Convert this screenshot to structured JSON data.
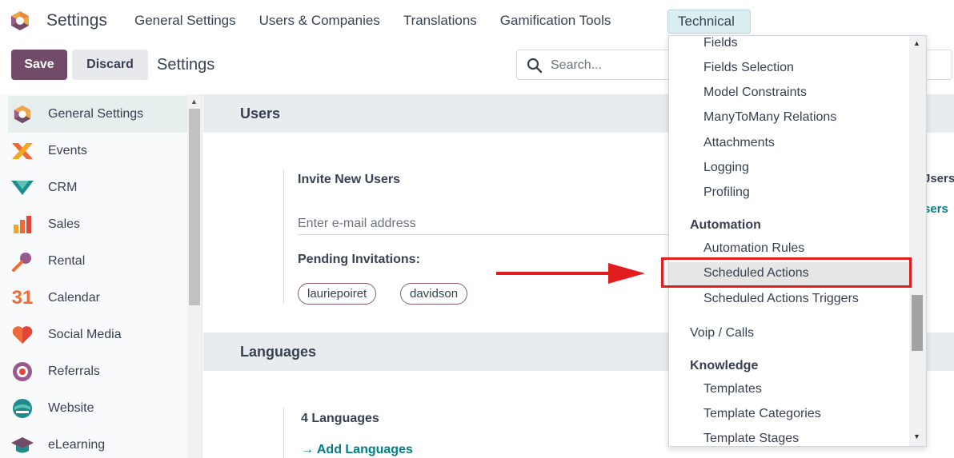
{
  "navbar": {
    "app_title": "Settings",
    "menu": [
      "General Settings",
      "Users & Companies",
      "Translations",
      "Gamification Tools"
    ],
    "active_menu": "Technical"
  },
  "control": {
    "save_label": "Save",
    "discard_label": "Discard",
    "breadcrumb": "Settings",
    "search_placeholder": "Search..."
  },
  "sidebar": {
    "items": [
      {
        "label": "General Settings",
        "icon": "odoo-logo-icon",
        "active": true
      },
      {
        "label": "Events",
        "icon": "events-icon"
      },
      {
        "label": "CRM",
        "icon": "crm-icon"
      },
      {
        "label": "Sales",
        "icon": "sales-icon"
      },
      {
        "label": "Rental",
        "icon": "rental-key-icon"
      },
      {
        "label": "Calendar",
        "icon": "calendar-icon",
        "icon_text": "31"
      },
      {
        "label": "Social Media",
        "icon": "social-heart-icon"
      },
      {
        "label": "Referrals",
        "icon": "referrals-icon"
      },
      {
        "label": "Website",
        "icon": "website-icon"
      },
      {
        "label": "eLearning",
        "icon": "elearning-icon"
      }
    ]
  },
  "main": {
    "users_section": "Users",
    "invite_title": "Invite New Users",
    "email_placeholder": "Enter e-mail address",
    "pending_title": "Pending Invitations:",
    "pending_tags": [
      "lauriepoiret",
      "davidson"
    ],
    "languages_section": "Languages",
    "languages_count": "4 Languages",
    "add_languages": "Add Languages",
    "right_partial_1": "Jsers",
    "right_partial_2": "sers"
  },
  "dropdown": {
    "items_top": [
      "Fields",
      "Fields Selection",
      "Model Constraints",
      "ManyToMany Relations",
      "Attachments",
      "Logging",
      "Profiling"
    ],
    "automation_header": "Automation",
    "automation_items": [
      "Automation Rules",
      "Scheduled Actions",
      "Scheduled Actions Triggers"
    ],
    "voip": "Voip / Calls",
    "knowledge_header": "Knowledge",
    "knowledge_items": [
      "Templates",
      "Template Categories",
      "Template Stages"
    ],
    "highlighted": "Scheduled Actions"
  },
  "colors": {
    "primary": "#714b67",
    "teal": "#017e84",
    "annotation_red": "#e21d1d"
  }
}
